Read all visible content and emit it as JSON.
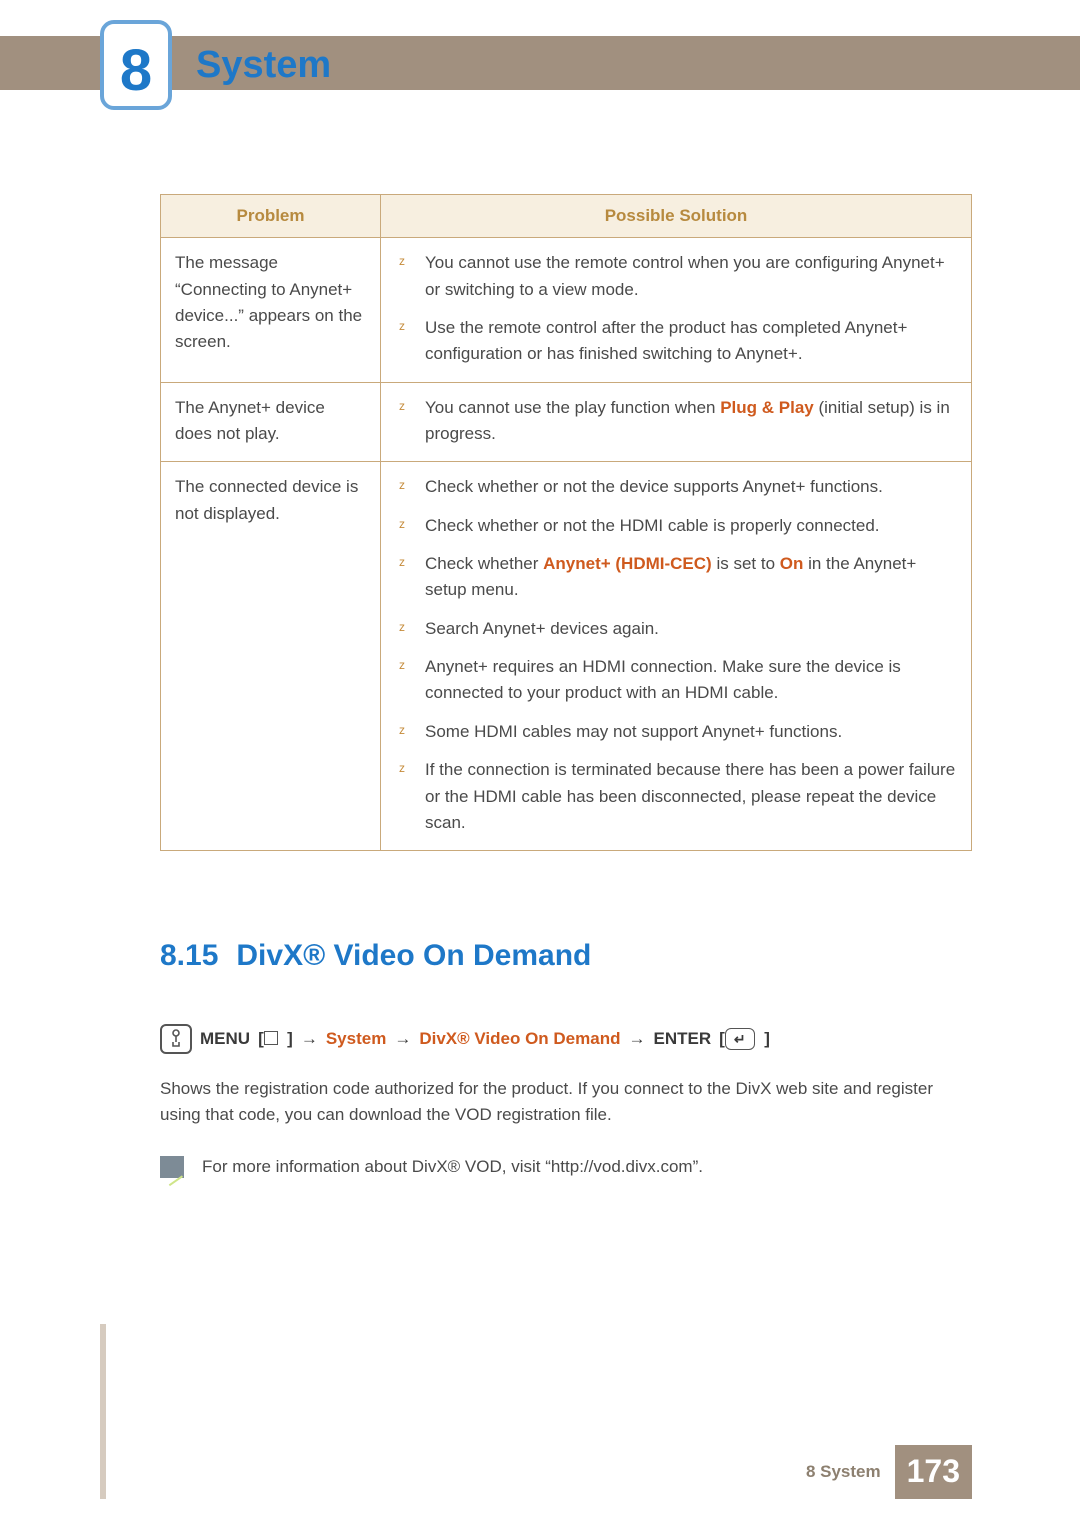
{
  "chapter": {
    "number": "8",
    "title": "System"
  },
  "table": {
    "headers": {
      "problem": "Problem",
      "solution": "Possible Solution"
    },
    "rows": [
      {
        "problem": "The message “Connecting to Anynet+ device...” appears on the screen.",
        "solutions": [
          {
            "text": "You cannot use the remote control when you are configuring Anynet+ or switching to a view mode."
          },
          {
            "text": "Use the remote control after the product has completed Anynet+ configuration or has finished switching to Anynet+."
          }
        ]
      },
      {
        "problem": "The Anynet+ device does not play.",
        "solutions": [
          {
            "pre": "You cannot use the play function when ",
            "hl": "Plug & Play",
            "post": " (initial setup) is in progress."
          }
        ]
      },
      {
        "problem": "The connected device is not displayed.",
        "solutions": [
          {
            "text": "Check whether or not the device supports Anynet+ functions."
          },
          {
            "text": "Check whether or not the HDMI cable is properly connected."
          },
          {
            "pre": "Check whether ",
            "hl": "Anynet+ (HDMI-CEC)",
            "mid": " is set to ",
            "hl2": "On",
            "post": " in the Anynet+ setup menu."
          },
          {
            "text": "Search Anynet+ devices again."
          },
          {
            "text": "Anynet+ requires an HDMI connection. Make sure the device is connected to your product with an HDMI cable."
          },
          {
            "text": "Some HDMI cables may not support Anynet+ functions."
          },
          {
            "text": "If the connection is terminated because there has been a power failure or the HDMI cable has been disconnected, please repeat the device scan."
          }
        ]
      }
    ]
  },
  "section": {
    "number": "8.15",
    "title": "DivX® Video On Demand",
    "menu_path": {
      "menu_label": "MENU",
      "items": [
        "System",
        "DivX® Video On Demand"
      ],
      "enter_label": "ENTER"
    },
    "body": "Shows the registration code authorized for the product. If you connect to the DivX web site and register using that code, you can download the VOD registration file.",
    "note": "For more information about DivX® VOD, visit “http://vod.divx.com”."
  },
  "footer": {
    "label": "8 System",
    "page": "173"
  },
  "chart_data": {
    "type": "table",
    "title": "Anynet+ Troubleshooting",
    "columns": [
      "Problem",
      "Possible Solution"
    ],
    "rows": [
      [
        "The message “Connecting to Anynet+ device...” appears on the screen.",
        "You cannot use the remote control when you are configuring Anynet+ or switching to a view mode."
      ],
      [
        "The message “Connecting to Anynet+ device...” appears on the screen.",
        "Use the remote control after the product has completed Anynet+ configuration or has finished switching to Anynet+."
      ],
      [
        "The Anynet+ device does not play.",
        "You cannot use the play function when Plug & Play (initial setup) is in progress."
      ],
      [
        "The connected device is not displayed.",
        "Check whether or not the device supports Anynet+ functions."
      ],
      [
        "The connected device is not displayed.",
        "Check whether or not the HDMI cable is properly connected."
      ],
      [
        "The connected device is not displayed.",
        "Check whether Anynet+ (HDMI-CEC) is set to On in the Anynet+ setup menu."
      ],
      [
        "The connected device is not displayed.",
        "Search Anynet+ devices again."
      ],
      [
        "The connected device is not displayed.",
        "Anynet+ requires an HDMI connection. Make sure the device is connected to your product with an HDMI cable."
      ],
      [
        "The connected device is not displayed.",
        "Some HDMI cables may not support Anynet+ functions."
      ],
      [
        "The connected device is not displayed.",
        "If the connection is terminated because there has been a power failure or the HDMI cable has been disconnected, please repeat the device scan."
      ]
    ]
  }
}
